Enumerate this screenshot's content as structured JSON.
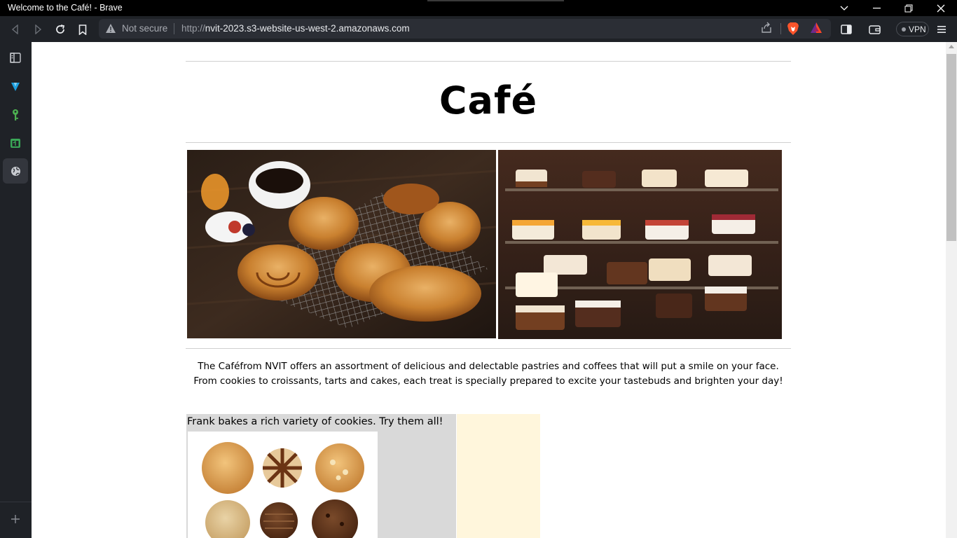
{
  "window": {
    "title": "Welcome to the Café! - Brave"
  },
  "toolbar": {
    "security_label": "Not secure",
    "url_scheme": "http://",
    "url_host": "nvit-2023.s3-website-us-west-2.amazonaws.com",
    "vpn_label": "VPN"
  },
  "page": {
    "heading": "Café",
    "description": "The Caféfrom NVIT offers an assortment of delicious and delectable pastries and coffees that will put a smile on your face. From cookies to croissants, tarts and cakes, each treat is specially prepared to excite your tastebuds and brighten your day!",
    "cookie_caption": "Frank bakes a rich variety of cookies. Try them all!"
  },
  "colors": {
    "browser_chrome": "#1f2227",
    "urlbar": "#2b2e35",
    "cookie_panel": "#d9d9d9",
    "cream_panel": "#fff6dc"
  }
}
